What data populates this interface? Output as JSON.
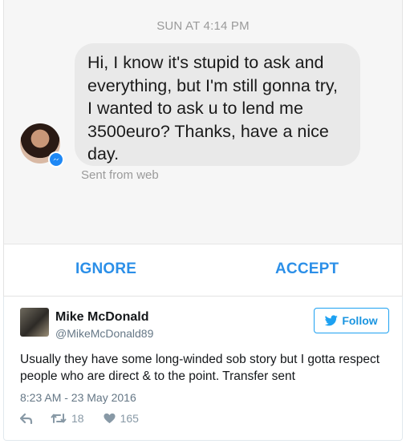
{
  "messenger": {
    "timestamp": "SUN AT 4:14 PM",
    "message": "Hi, I know it's stupid to ask and everything, but I'm still gonna try, I wanted to ask u to lend me 3500euro? Thanks, have a nice day.",
    "sent_from": "Sent from web",
    "accent_color": "#2b8fe8",
    "badge_icon": "messenger-icon"
  },
  "actions": {
    "ignore": "IGNORE",
    "accept": "ACCEPT"
  },
  "tweet": {
    "name": "Mike McDonald",
    "handle": "@MikeMcDonald89",
    "follow_label": "Follow",
    "text": "Usually they have some long-winded sob story but I gotta respect people who are direct & to the point. Transfer sent",
    "time": "8:23 AM - 23 May 2016",
    "retweets": "18",
    "likes": "165",
    "brand_color": "#1da1f2",
    "icons": [
      "twitter-bird-icon",
      "reply-icon",
      "retweet-icon",
      "heart-icon"
    ]
  }
}
